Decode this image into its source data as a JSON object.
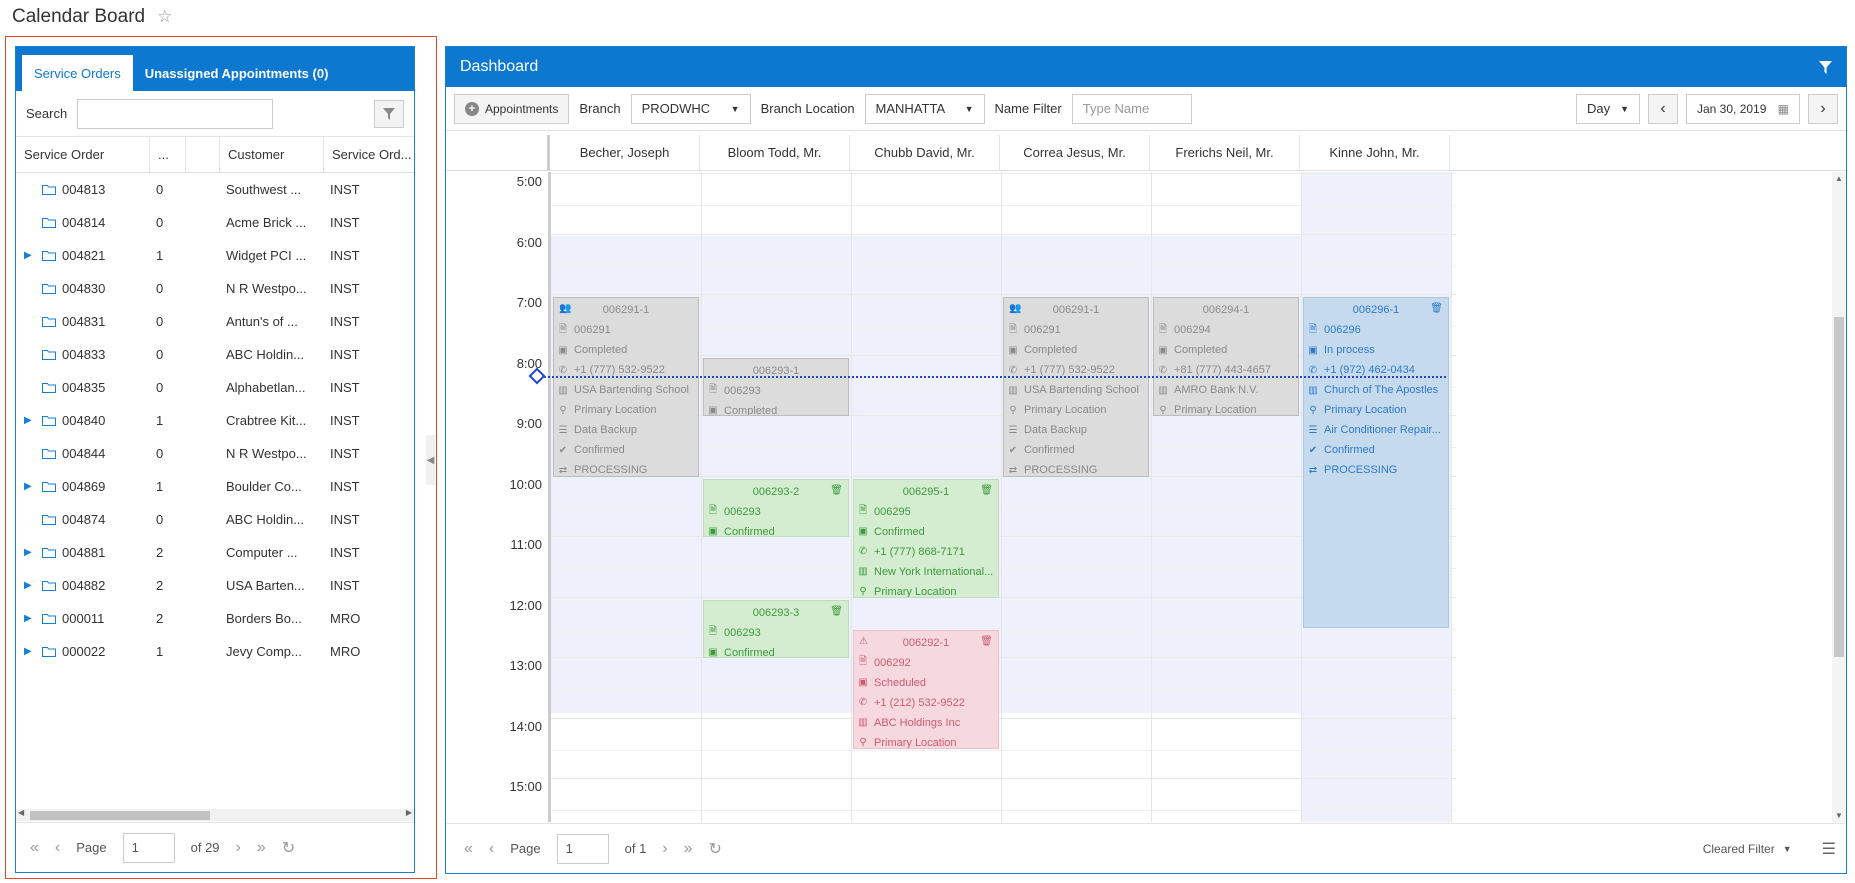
{
  "page": {
    "title": "Calendar Board",
    "star_icon": "star-icon"
  },
  "left": {
    "tabs": [
      {
        "label": "Service Orders",
        "active": true
      },
      {
        "label": "Unassigned Appointments (0)",
        "active": false
      }
    ],
    "search_label": "Search",
    "columns": [
      "Service Order",
      "...",
      "",
      "Customer",
      "Service Ord..."
    ],
    "rows": [
      {
        "id": "004813",
        "n": "0",
        "customer": "Southwest ...",
        "type": "INST",
        "expandable": false
      },
      {
        "id": "004814",
        "n": "0",
        "customer": "Acme Brick ...",
        "type": "INST",
        "expandable": false
      },
      {
        "id": "004821",
        "n": "1",
        "customer": "Widget PCI ...",
        "type": "INST",
        "expandable": true
      },
      {
        "id": "004830",
        "n": "0",
        "customer": "N R Westpo...",
        "type": "INST",
        "expandable": false
      },
      {
        "id": "004831",
        "n": "0",
        "customer": "Antun's of ...",
        "type": "INST",
        "expandable": false
      },
      {
        "id": "004833",
        "n": "0",
        "customer": "ABC Holdin...",
        "type": "INST",
        "expandable": false
      },
      {
        "id": "004835",
        "n": "0",
        "customer": "Alphabetlan...",
        "type": "INST",
        "expandable": false
      },
      {
        "id": "004840",
        "n": "1",
        "customer": "Crabtree Kit...",
        "type": "INST",
        "expandable": true
      },
      {
        "id": "004844",
        "n": "0",
        "customer": "N R Westpo...",
        "type": "INST",
        "expandable": false
      },
      {
        "id": "004869",
        "n": "1",
        "customer": "Boulder Co...",
        "type": "INST",
        "expandable": true
      },
      {
        "id": "004874",
        "n": "0",
        "customer": "ABC Holdin...",
        "type": "INST",
        "expandable": false
      },
      {
        "id": "004881",
        "n": "2",
        "customer": "Computer ...",
        "type": "INST",
        "expandable": true
      },
      {
        "id": "004882",
        "n": "2",
        "customer": "USA Barten...",
        "type": "INST",
        "expandable": true
      },
      {
        "id": "000011",
        "n": "2",
        "customer": "Borders Bo...",
        "type": "MRO",
        "expandable": true
      },
      {
        "id": "000022",
        "n": "1",
        "customer": "Jevy Comp...",
        "type": "MRO",
        "expandable": true
      }
    ],
    "pager": {
      "label": "Page",
      "value": "1",
      "of": "of 29"
    }
  },
  "dash": {
    "title": "Dashboard",
    "toolbar": {
      "appointments": "Appointments",
      "branch_label": "Branch",
      "branch_value": "PRODWHC",
      "location_label": "Branch Location",
      "location_value": "MANHATTA",
      "name_label": "Name Filter",
      "name_placeholder": "Type Name",
      "view": "Day",
      "date": "Jan 30, 2019"
    },
    "resources": [
      "Becher, Joseph",
      "Bloom Todd, Mr.",
      "Chubb David, Mr.",
      "Correa Jesus, Mr.",
      "Frerichs Neil, Mr.",
      "Kinne John, Mr."
    ],
    "times": [
      "5:00",
      "6:00",
      "7:00",
      "8:00",
      "9:00",
      "10:00",
      "11:00",
      "12:00",
      "13:00",
      "14:00",
      "15:00"
    ],
    "appointments": [
      {
        "col": 0,
        "start": 7.0,
        "end": 10.0,
        "color": "grey",
        "title": "006291-1",
        "head_icon": "group-icon",
        "lines": [
          [
            "doc",
            "006291"
          ],
          [
            "cal",
            "Completed"
          ],
          [
            "phone",
            "+1 (777) 532-9522"
          ],
          [
            "building",
            "USA Bartending School"
          ],
          [
            "pin",
            "Primary Location"
          ],
          [
            "list",
            "Data Backup"
          ],
          [
            "check",
            "Confirmed"
          ],
          [
            "sync",
            "PROCESSING"
          ]
        ]
      },
      {
        "col": 1,
        "start": 8.0,
        "end": 9.0,
        "color": "grey",
        "title": "006293-1",
        "lines": [
          [
            "doc",
            "006293"
          ],
          [
            "cal",
            "Completed"
          ]
        ]
      },
      {
        "col": 1,
        "start": 10.0,
        "end": 11.0,
        "color": "green",
        "title": "006293-2",
        "trash": true,
        "lines": [
          [
            "doc",
            "006293"
          ],
          [
            "cal",
            "Confirmed"
          ]
        ]
      },
      {
        "col": 1,
        "start": 12.0,
        "end": 13.0,
        "color": "green",
        "title": "006293-3",
        "trash": true,
        "lines": [
          [
            "doc",
            "006293"
          ],
          [
            "cal",
            "Confirmed"
          ]
        ]
      },
      {
        "col": 2,
        "start": 10.0,
        "end": 12.0,
        "color": "green",
        "title": "006295-1",
        "trash": true,
        "lines": [
          [
            "doc",
            "006295"
          ],
          [
            "cal",
            "Confirmed"
          ],
          [
            "phone",
            "+1 (777) 868-7171"
          ],
          [
            "building",
            "New York International..."
          ],
          [
            "pin",
            "Primary Location"
          ]
        ]
      },
      {
        "col": 2,
        "start": 12.5,
        "end": 14.5,
        "color": "pink",
        "title": "006292-1",
        "trash": true,
        "head_icon": "warning-icon",
        "lines": [
          [
            "doc",
            "006292"
          ],
          [
            "cal",
            "Scheduled"
          ],
          [
            "phone",
            "+1 (212) 532-9522"
          ],
          [
            "building",
            "ABC Holdings Inc"
          ],
          [
            "pin",
            "Primary Location"
          ]
        ]
      },
      {
        "col": 3,
        "start": 7.0,
        "end": 10.0,
        "color": "grey",
        "title": "006291-1",
        "head_icon": "group-icon",
        "lines": [
          [
            "doc",
            "006291"
          ],
          [
            "cal",
            "Completed"
          ],
          [
            "phone",
            "+1 (777) 532-9522"
          ],
          [
            "building",
            "USA Bartending School"
          ],
          [
            "pin",
            "Primary Location"
          ],
          [
            "list",
            "Data Backup"
          ],
          [
            "check",
            "Confirmed"
          ],
          [
            "sync",
            "PROCESSING"
          ]
        ]
      },
      {
        "col": 4,
        "start": 7.0,
        "end": 9.0,
        "color": "grey",
        "title": "006294-1",
        "lines": [
          [
            "doc",
            "006294"
          ],
          [
            "cal",
            "Completed"
          ],
          [
            "phone",
            "+81 (777) 443-4657"
          ],
          [
            "building",
            "AMRO Bank N.V."
          ],
          [
            "pin",
            "Primary Location"
          ]
        ]
      },
      {
        "col": 5,
        "start": 7.0,
        "end": 12.5,
        "color": "blue",
        "title": "006296-1",
        "trash": true,
        "lines": [
          [
            "doc",
            "006296"
          ],
          [
            "cal",
            "In process"
          ],
          [
            "phone",
            "+1 (972) 462-0434"
          ],
          [
            "building",
            "Church of The Apostles"
          ],
          [
            "pin",
            "Primary Location"
          ],
          [
            "list",
            "Air Conditioner Repair..."
          ],
          [
            "check",
            "Confirmed"
          ],
          [
            "sync",
            "PROCESSING"
          ]
        ]
      }
    ],
    "pager": {
      "label": "Page",
      "value": "1",
      "of": "of 1",
      "filter": "Cleared Filter"
    }
  },
  "colors": {
    "accent": "#0c78d0",
    "highlight": "#e8452c"
  }
}
